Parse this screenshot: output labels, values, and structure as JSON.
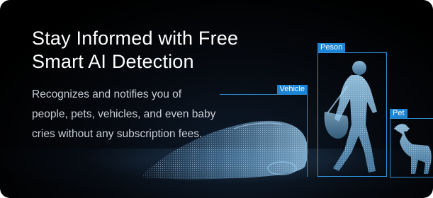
{
  "headline": {
    "line1": "Stay Informed with Free",
    "line2": "Smart AI Detection"
  },
  "body": {
    "line1": "Recognizes and notifies you of",
    "line2": "people, pets, vehicles, and even baby",
    "line3": "cries without any subscription fees."
  },
  "detections": {
    "vehicle": {
      "label": "Vehicle"
    },
    "person": {
      "label": "Peson"
    },
    "pet": {
      "label": "Pet"
    }
  },
  "colors": {
    "background": "#000000",
    "detection_box": "#2f8fd6",
    "detection_label_bg": "#1c84d4",
    "headline_text": "#ffffff",
    "body_text": "#c9ced6",
    "hologram": "#6fb4e8"
  }
}
